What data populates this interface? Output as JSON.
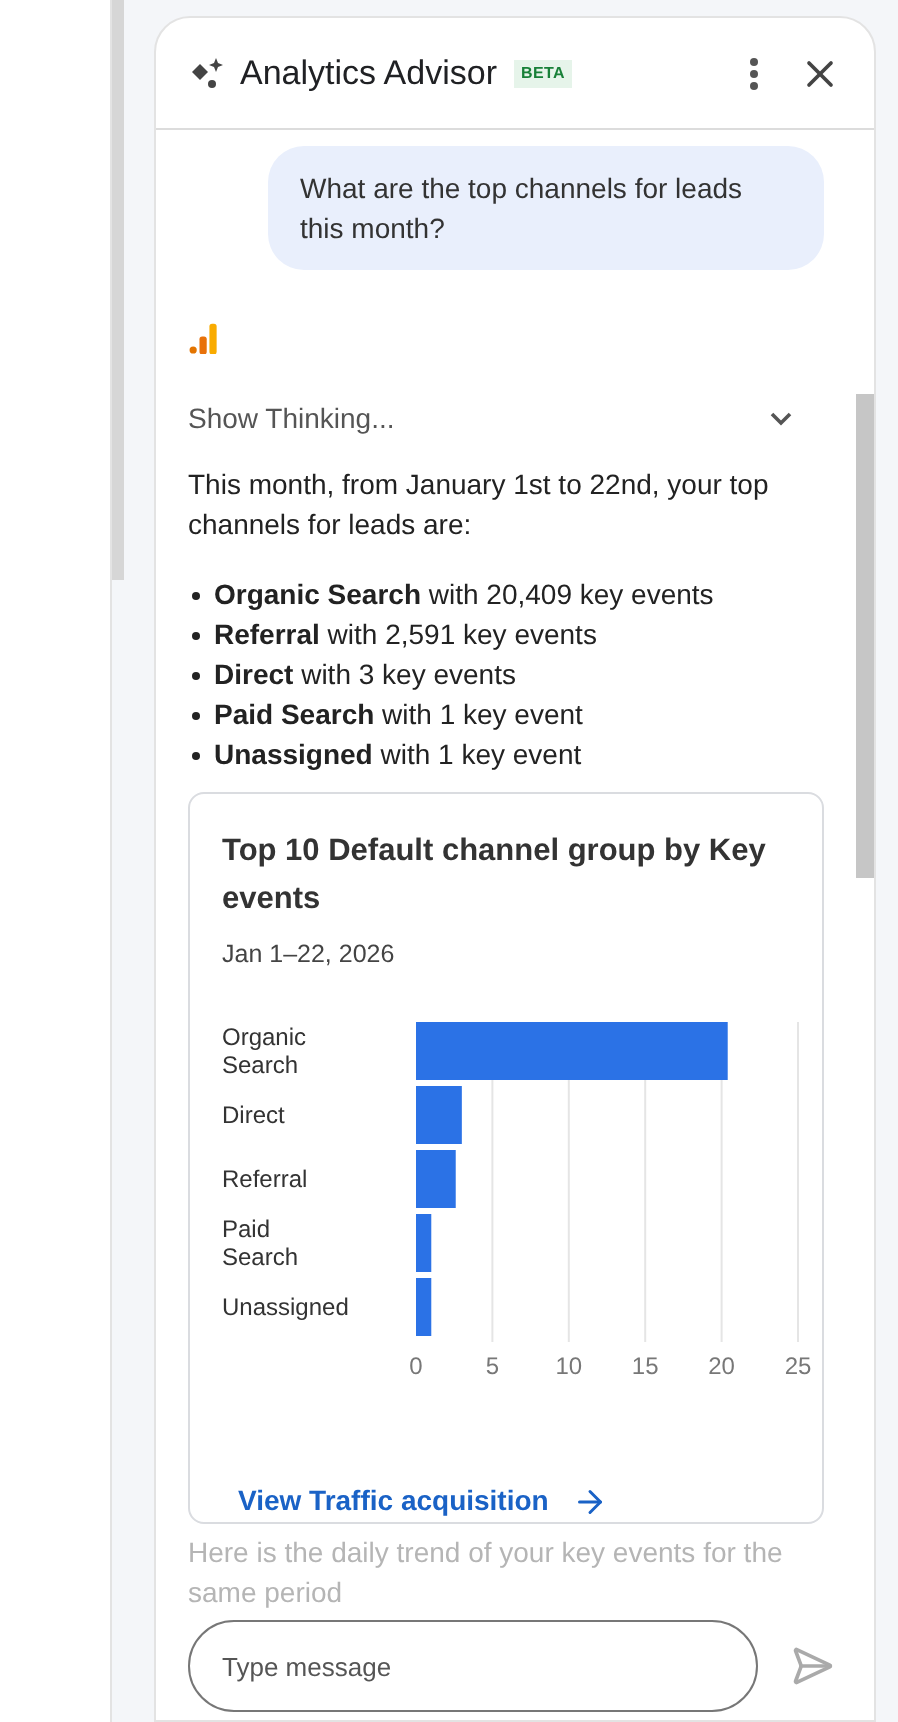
{
  "panel": {
    "title": "Analytics Advisor",
    "badge": "BETA"
  },
  "messages": {
    "user": "What are the top channels for leads this month?",
    "thinking": "Show Thinking...",
    "intro": "This month, from January 1st to 22nd, your top channels for leads are:",
    "bullets": [
      "**Organic Search** with 20,409 key events",
      "**Referral** with 2,591 key events",
      "**Direct** with 3 key events",
      "**Paid Search** with 1 key event",
      "**Unassigned** with 1 key event"
    ],
    "card": {
      "title": "Top 10 Default channel group by Key events",
      "date": "Jan 1–22, 2026",
      "chart_data": {
        "type": "bar",
        "orientation": "horizontal",
        "categories": [
          "Organic Search",
          "Direct",
          "Referral",
          "Paid Search",
          "Unassigned"
        ],
        "values": [
          20.4,
          3,
          2.6,
          1,
          1
        ],
        "xlim": [
          0,
          25
        ],
        "xticks": [
          0,
          5,
          10,
          15,
          20,
          25
        ],
        "grid": true
      },
      "link": "View Traffic acquisition"
    },
    "followup": "Here is the daily trend of your key events for the same period"
  },
  "composer": {
    "placeholder": "Type message"
  }
}
